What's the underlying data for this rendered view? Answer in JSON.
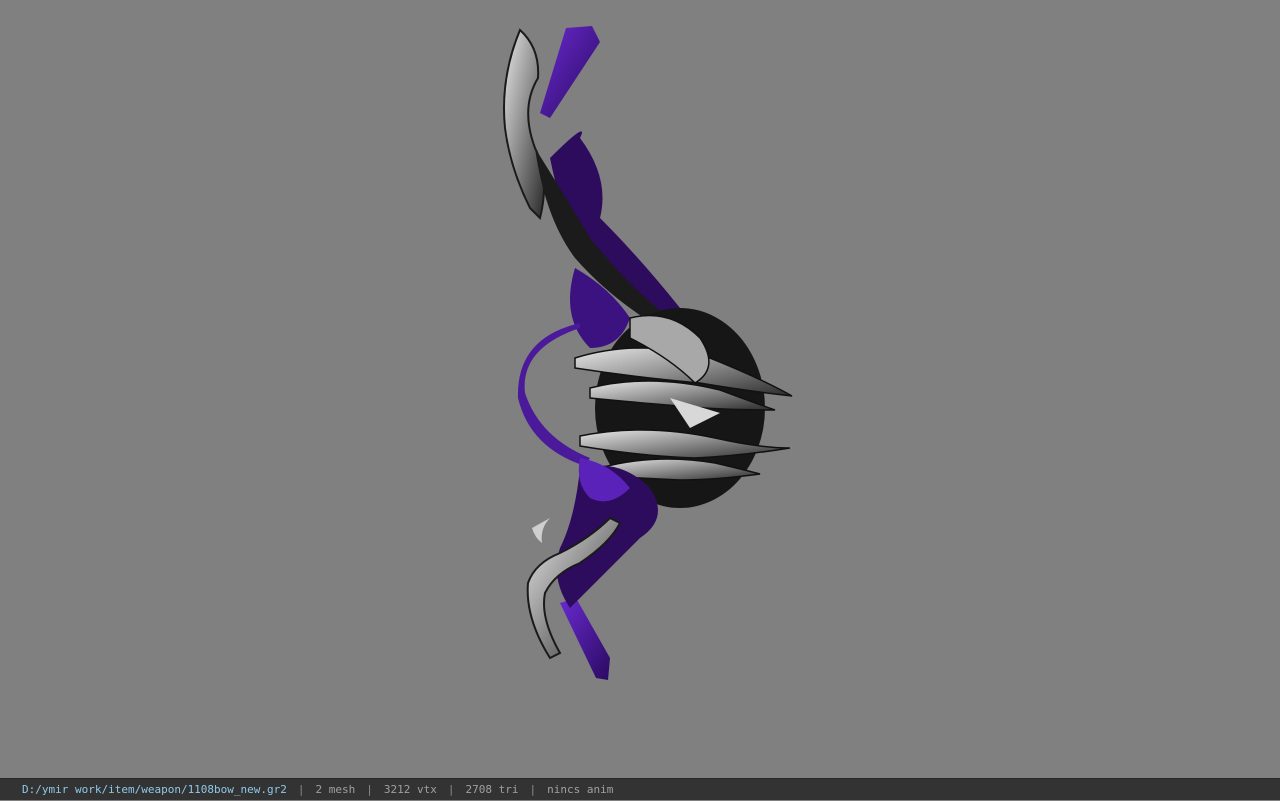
{
  "viewport": {
    "background": "#808080",
    "model_name": "bow-model"
  },
  "status": {
    "file_path": "D:/ymir work/item/weapon/1108bow_new.gr2",
    "separator": "|",
    "mesh": "2 mesh",
    "vtx": "3212 vtx",
    "tri": "2708 tri",
    "anim": "nincs anim"
  },
  "colors": {
    "path_text": "#8fc8e8",
    "status_text": "#a0a0a0",
    "status_bg": "#333333",
    "bow_purple": "#4a1a9a",
    "bow_metal": "#b8b8b8"
  }
}
